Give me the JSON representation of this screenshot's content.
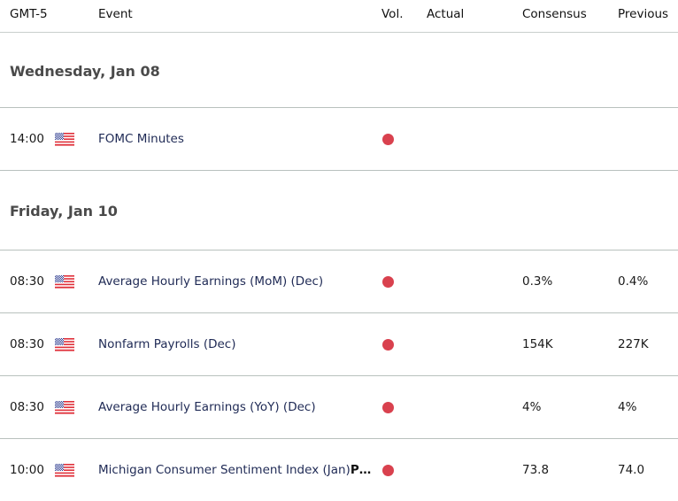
{
  "colors": {
    "volatility_high": "#d9414e",
    "event_text": "#1f2a55",
    "day_header_text": "#4a4a4a",
    "divider": "#b9c1be"
  },
  "header": {
    "timezone": "GMT-5",
    "event": "Event",
    "volatility": "Vol.",
    "actual": "Actual",
    "consensus": "Consensus",
    "previous": "Previous"
  },
  "days": [
    {
      "label": "Wednesday, Jan 08",
      "events": [
        {
          "time": "14:00",
          "country_icon": "us-flag-icon",
          "event": "FOMC Minutes",
          "event_suffix": "",
          "volatility": "high",
          "actual": "",
          "consensus": "",
          "previous": ""
        }
      ]
    },
    {
      "label": "Friday, Jan 10",
      "events": [
        {
          "time": "08:30",
          "country_icon": "us-flag-icon",
          "event": "Average Hourly Earnings (MoM) (Dec)",
          "event_suffix": "",
          "volatility": "high",
          "actual": "",
          "consensus": "0.3%",
          "previous": "0.4%"
        },
        {
          "time": "08:30",
          "country_icon": "us-flag-icon",
          "event": "Nonfarm Payrolls (Dec)",
          "event_suffix": "",
          "volatility": "high",
          "actual": "",
          "consensus": "154K",
          "previous": "227K"
        },
        {
          "time": "08:30",
          "country_icon": "us-flag-icon",
          "event": "Average Hourly Earnings (YoY) (Dec)",
          "event_suffix": "",
          "volatility": "high",
          "actual": "",
          "consensus": "4%",
          "previous": "4%"
        },
        {
          "time": "10:00",
          "country_icon": "us-flag-icon",
          "event": "Michigan Consumer Sentiment Index (Jan)",
          "event_suffix": "P…",
          "volatility": "high",
          "actual": "",
          "consensus": "73.8",
          "previous": "74.0"
        }
      ]
    }
  ]
}
